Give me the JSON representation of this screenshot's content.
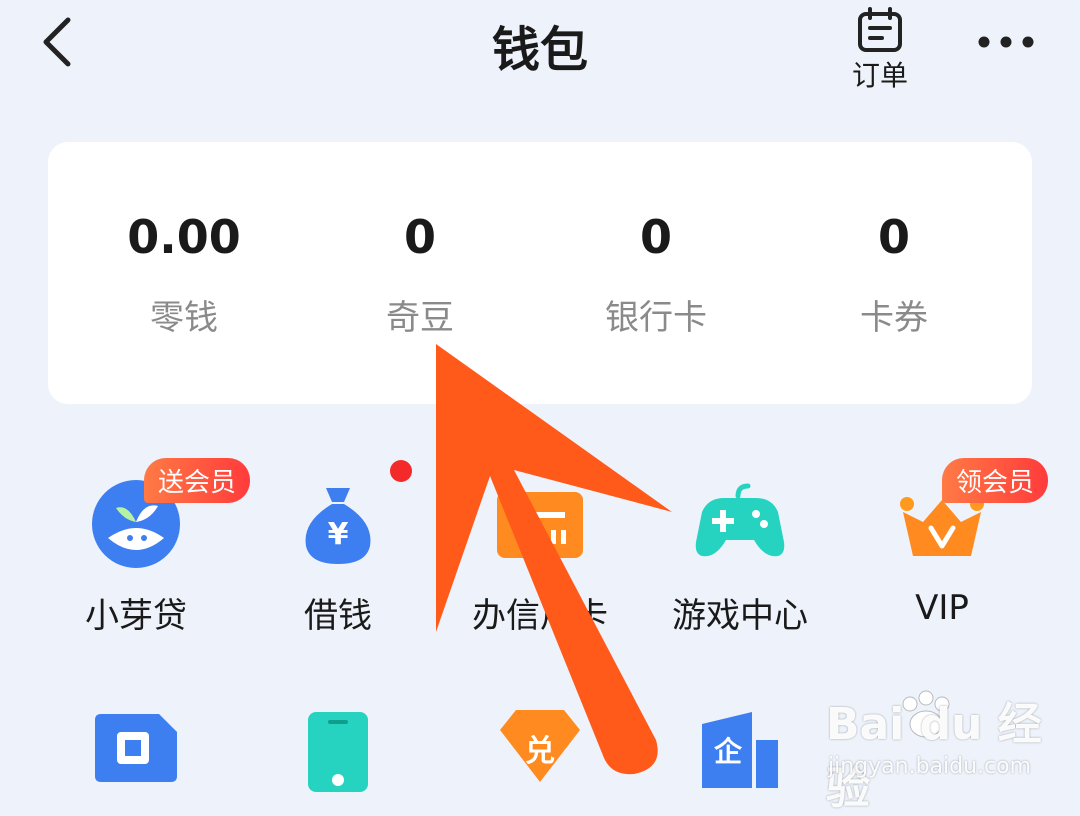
{
  "header": {
    "title": "钱包",
    "orders_label": "订单"
  },
  "balances": [
    {
      "value": "0.00",
      "label": "零钱"
    },
    {
      "value": "0",
      "label": "奇豆"
    },
    {
      "value": "0",
      "label": "银行卡"
    },
    {
      "value": "0",
      "label": "卡券"
    }
  ],
  "services": [
    {
      "label": "小芽贷",
      "badge": "送会员",
      "icon": "sprout-icon"
    },
    {
      "label": "借钱",
      "icon": "money-bag-icon"
    },
    {
      "label": "办信用卡",
      "icon": "credit-card-icon"
    },
    {
      "label": "游戏中心",
      "icon": "gamepad-icon"
    },
    {
      "label": "VIP",
      "badge": "领会员",
      "icon": "vip-crown-icon"
    }
  ],
  "services_row2": [
    {
      "icon": "sim-card-icon"
    },
    {
      "icon": "phone-icon"
    },
    {
      "icon": "exchange-icon",
      "text": "兑"
    },
    {
      "icon": "enterprise-icon",
      "text": "企"
    }
  ],
  "watermark": {
    "brand": "Bai du 经验",
    "url": "jingyan.baidu.com"
  },
  "colors": {
    "background": "#eef3fb",
    "blue": "#4a86f0",
    "orange": "#ff8a1f",
    "teal": "#26d3c0",
    "arrow": "#ff5a1a",
    "badge": "#ff4a3a"
  }
}
